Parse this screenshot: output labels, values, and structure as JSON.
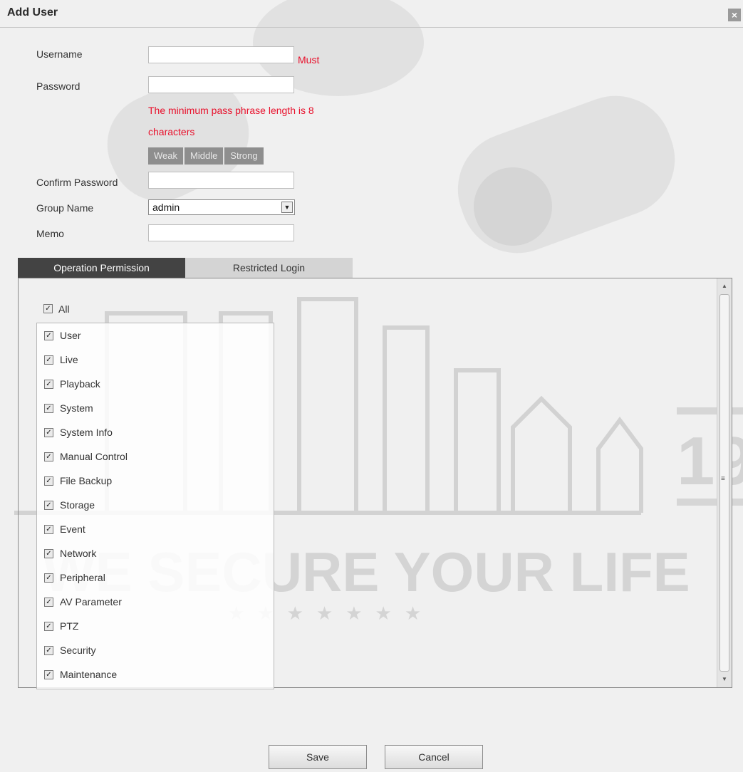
{
  "dialog": {
    "title": "Add User",
    "close_label": "×"
  },
  "form": {
    "username_label": "Username",
    "username_value": "",
    "username_required": "Must",
    "password_label": "Password",
    "password_value": "",
    "password_hint_line1": "The minimum pass phrase length is 8",
    "password_hint_line2": "characters",
    "strength_levels": [
      "Weak",
      "Middle",
      "Strong"
    ],
    "confirm_label": "Confirm Password",
    "confirm_value": "",
    "group_label": "Group Name",
    "group_value": "admin",
    "memo_label": "Memo",
    "memo_value": ""
  },
  "tabs": [
    {
      "label": "Operation Permission",
      "active": true
    },
    {
      "label": "Restricted Login",
      "active": false
    }
  ],
  "permissions": {
    "all_label": "All",
    "all_checked": true,
    "items": [
      {
        "label": "User",
        "checked": true
      },
      {
        "label": "Live",
        "checked": true
      },
      {
        "label": "Playback",
        "checked": true
      },
      {
        "label": "System",
        "checked": true
      },
      {
        "label": "System Info",
        "checked": true
      },
      {
        "label": "Manual Control",
        "checked": true
      },
      {
        "label": "File Backup",
        "checked": true
      },
      {
        "label": "Storage",
        "checked": true
      },
      {
        "label": "Event",
        "checked": true
      },
      {
        "label": "Network",
        "checked": true
      },
      {
        "label": "Peripheral",
        "checked": true
      },
      {
        "label": "AV Parameter",
        "checked": true
      },
      {
        "label": "PTZ",
        "checked": true
      },
      {
        "label": "Security",
        "checked": true
      },
      {
        "label": "Maintenance",
        "checked": true
      }
    ]
  },
  "footer": {
    "save_label": "Save",
    "cancel_label": "Cancel"
  },
  "watermark": {
    "slogan": "WE SECURE YOUR LIFE",
    "badge_digits": "19"
  },
  "icons": {
    "checkmark": "checkmark-icon",
    "close": "close-icon",
    "dropdown": "chevron-down-icon"
  }
}
